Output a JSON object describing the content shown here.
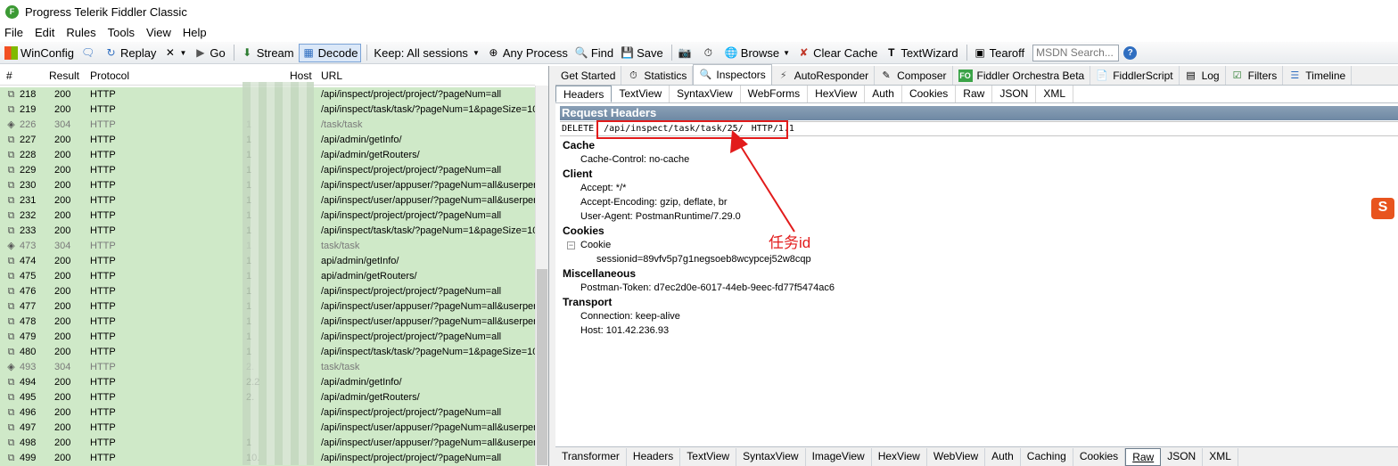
{
  "window": {
    "title": "Progress Telerik Fiddler Classic",
    "logo_letter": "F"
  },
  "menu": [
    "File",
    "Edit",
    "Rules",
    "Tools",
    "View",
    "Help"
  ],
  "toolbar": {
    "winconfig": "WinConfig",
    "replay": "Replay",
    "go": "Go",
    "stream": "Stream",
    "decode": "Decode",
    "keep": "Keep: All sessions",
    "any_process": "Any Process",
    "find": "Find",
    "save": "Save",
    "browse": "Browse",
    "clear_cache": "Clear Cache",
    "textwizard": "TextWizard",
    "tearoff": "Tearoff",
    "msdn_placeholder": "MSDN Search...",
    "help": "?"
  },
  "sessions": {
    "columns": [
      "#",
      "Result",
      "Protocol",
      "Host",
      "URL"
    ],
    "rows": [
      {
        "id": "218",
        "result": "200",
        "protocol": "HTTP",
        "host": "",
        "url": "/api/inspect/project/project/?pageNum=all",
        "dim": false
      },
      {
        "id": "219",
        "result": "200",
        "protocol": "HTTP",
        "host": "",
        "url": "/api/inspect/task/task/?pageNum=1&pageSize=10",
        "dim": false
      },
      {
        "id": "226",
        "result": "304",
        "protocol": "HTTP",
        "host": "1",
        "url": "/task/task",
        "dim": true
      },
      {
        "id": "227",
        "result": "200",
        "protocol": "HTTP",
        "host": "1",
        "url": "/api/admin/getInfo/",
        "dim": false
      },
      {
        "id": "228",
        "result": "200",
        "protocol": "HTTP",
        "host": "1",
        "url": "/api/admin/getRouters/",
        "dim": false
      },
      {
        "id": "229",
        "result": "200",
        "protocol": "HTTP",
        "host": "1",
        "url": "/api/inspect/project/project/?pageNum=all",
        "dim": false
      },
      {
        "id": "230",
        "result": "200",
        "protocol": "HTTP",
        "host": "1",
        "url": "/api/inspect/user/appuser/?pageNum=all&userper",
        "dim": false
      },
      {
        "id": "231",
        "result": "200",
        "protocol": "HTTP",
        "host": "1",
        "url": "/api/inspect/user/appuser/?pageNum=all&userper",
        "dim": false
      },
      {
        "id": "232",
        "result": "200",
        "protocol": "HTTP",
        "host": "1",
        "url": "/api/inspect/project/project/?pageNum=all",
        "dim": false
      },
      {
        "id": "233",
        "result": "200",
        "protocol": "HTTP",
        "host": "1",
        "url": "/api/inspect/task/task/?pageNum=1&pageSize=10",
        "dim": false
      },
      {
        "id": "473",
        "result": "304",
        "protocol": "HTTP",
        "host": "1",
        "url": "task/task",
        "dim": true
      },
      {
        "id": "474",
        "result": "200",
        "protocol": "HTTP",
        "host": "1",
        "url": "api/admin/getInfo/",
        "dim": false
      },
      {
        "id": "475",
        "result": "200",
        "protocol": "HTTP",
        "host": "1",
        "url": "api/admin/getRouters/",
        "dim": false
      },
      {
        "id": "476",
        "result": "200",
        "protocol": "HTTP",
        "host": "1",
        "url": "/api/inspect/project/project/?pageNum=all",
        "dim": false
      },
      {
        "id": "477",
        "result": "200",
        "protocol": "HTTP",
        "host": "1",
        "url": "/api/inspect/user/appuser/?pageNum=all&userper",
        "dim": false
      },
      {
        "id": "478",
        "result": "200",
        "protocol": "HTTP",
        "host": "1",
        "url": "/api/inspect/user/appuser/?pageNum=all&userper",
        "dim": false
      },
      {
        "id": "479",
        "result": "200",
        "protocol": "HTTP",
        "host": "1",
        "url": "/api/inspect/project/project/?pageNum=all",
        "dim": false
      },
      {
        "id": "480",
        "result": "200",
        "protocol": "HTTP",
        "host": "1",
        "url": "/api/inspect/task/task/?pageNum=1&pageSize=10",
        "dim": false
      },
      {
        "id": "493",
        "result": "304",
        "protocol": "HTTP",
        "host": "2.",
        "url": "task/task",
        "dim": true
      },
      {
        "id": "494",
        "result": "200",
        "protocol": "HTTP",
        "host": "2.2",
        "url": "/api/admin/getInfo/",
        "dim": false
      },
      {
        "id": "495",
        "result": "200",
        "protocol": "HTTP",
        "host": "2.",
        "url": "/api/admin/getRouters/",
        "dim": false
      },
      {
        "id": "496",
        "result": "200",
        "protocol": "HTTP",
        "host": "",
        "url": "/api/inspect/project/project/?pageNum=all",
        "dim": false
      },
      {
        "id": "497",
        "result": "200",
        "protocol": "HTTP",
        "host": "",
        "url": "/api/inspect/user/appuser/?pageNum=all&userper",
        "dim": false
      },
      {
        "id": "498",
        "result": "200",
        "protocol": "HTTP",
        "host": "1",
        "url": "/api/inspect/user/appuser/?pageNum=all&userper",
        "dim": false
      },
      {
        "id": "499",
        "result": "200",
        "protocol": "HTTP",
        "host": "10.",
        "url": "/api/inspect/project/project/?pageNum=all",
        "dim": false
      }
    ]
  },
  "main_tabs": [
    "Get Started",
    "Statistics",
    "Inspectors",
    "AutoResponder",
    "Composer",
    "Fiddler Orchestra Beta",
    "FiddlerScript",
    "Log",
    "Filters",
    "Timeline"
  ],
  "orchestra_badge": "FO",
  "request_tabs": [
    "Headers",
    "TextView",
    "SyntaxView",
    "WebForms",
    "HexView",
    "Auth",
    "Cookies",
    "Raw",
    "JSON",
    "XML"
  ],
  "request_headers": {
    "section_title": "Request Headers",
    "method": "DELETE",
    "path": "/api/inspect/task/task/25/",
    "protocol": "HTTP/1.1",
    "groups": {
      "cache": {
        "name": "Cache",
        "items": [
          "Cache-Control: no-cache"
        ]
      },
      "client": {
        "name": "Client",
        "items": [
          "Accept: */*",
          "Accept-Encoding: gzip, deflate, br",
          "User-Agent: PostmanRuntime/7.29.0"
        ]
      },
      "cookies": {
        "name": "Cookies",
        "cookie_label": "Cookie",
        "toggle": "−",
        "cookie_value": "sessionid=89vfv5p7g1negsoeb8wcypcej52w8cqp"
      },
      "misc": {
        "name": "Miscellaneous",
        "items": [
          "Postman-Token: d7ec2d0e-6017-44eb-9eec-fd77f5474ac6"
        ]
      },
      "transport": {
        "name": "Transport",
        "items": [
          "Connection: keep-alive",
          "Host: 101.42.236.93"
        ]
      }
    }
  },
  "annotation": {
    "text": "任务id",
    "color": "#e21b1b"
  },
  "sogou_badge": "S",
  "response_tabs": [
    "Transformer",
    "Headers",
    "TextView",
    "SyntaxView",
    "ImageView",
    "HexView",
    "WebView",
    "Auth",
    "Caching",
    "Cookies",
    "Raw",
    "JSON",
    "XML"
  ],
  "colors": {
    "session_bg": "#cfe9c8",
    "header_bar": "#7b93ab",
    "accent_red": "#e21b1b"
  }
}
